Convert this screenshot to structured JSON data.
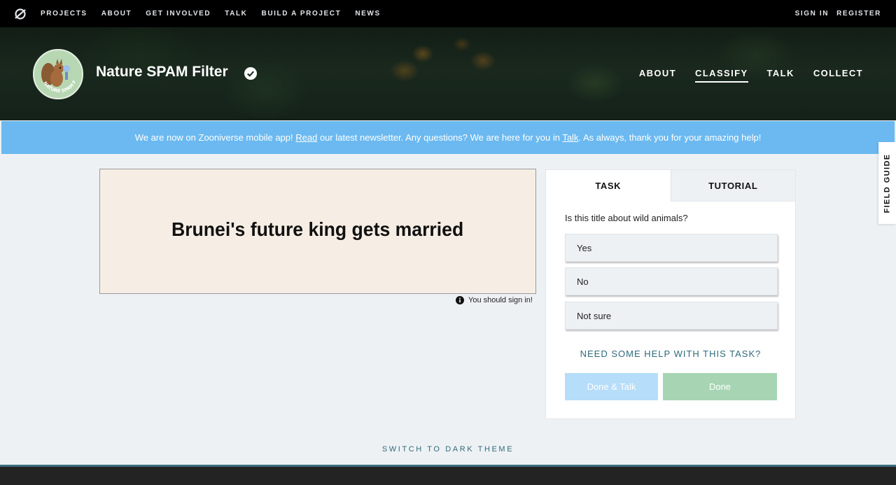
{
  "topnav": {
    "links": [
      "PROJECTS",
      "ABOUT",
      "GET INVOLVED",
      "TALK",
      "BUILD A PROJECT",
      "NEWS"
    ],
    "sign_in": "SIGN IN",
    "register": "REGISTER"
  },
  "project": {
    "title": "Nature SPAM Filter",
    "avatar_text": "NATURE SPAM FILTER",
    "nav": [
      {
        "label": "ABOUT",
        "active": false
      },
      {
        "label": "CLASSIFY",
        "active": true
      },
      {
        "label": "TALK",
        "active": false
      },
      {
        "label": "COLLECT",
        "active": false
      }
    ]
  },
  "announcement": {
    "before_read": "We are now on Zooniverse mobile app! ",
    "read_link": "Read",
    "middle": " our latest newsletter. Any questions? We are here for you in ",
    "talk_link": "Talk",
    "after": ". As always, thank you for your amazing help!"
  },
  "subject": {
    "headline": "Brunei's future king gets married",
    "signin_note": "You should sign in!"
  },
  "task": {
    "tabs": [
      "TASK",
      "TUTORIAL"
    ],
    "question": "Is this title about wild animals?",
    "answers": [
      "Yes",
      "No",
      "Not sure"
    ],
    "help_link": "NEED SOME HELP WITH THIS TASK?",
    "done_talk_label": "Done & Talk",
    "done_label": "Done"
  },
  "field_guide_label": "FIELD GUIDE",
  "theme_switch_label": "SWITCH TO DARK THEME",
  "colors": {
    "announcement_bg": "#6bb9f0",
    "done_talk_bg": "#b6ddfa",
    "done_bg": "#a7d5b3",
    "link_teal": "#2f6b7a"
  }
}
